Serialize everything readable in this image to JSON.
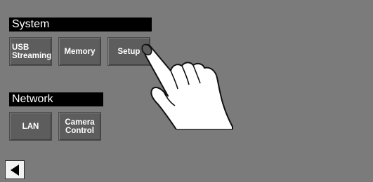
{
  "sections": {
    "system": {
      "title": "System",
      "buttons": [
        {
          "label": "USB\nStreaming"
        },
        {
          "label": "Memory"
        },
        {
          "label": "Setup"
        }
      ]
    },
    "network": {
      "title": "Network",
      "buttons": [
        {
          "label": "LAN"
        },
        {
          "label": "Camera\nControl"
        }
      ]
    }
  },
  "icons": {
    "back": "back-arrow-icon",
    "hand": "pointing-hand-icon"
  },
  "colors": {
    "background": "#7b7b7b",
    "tile": "#5d5d5d",
    "header": "#000000",
    "text": "#ffffff"
  }
}
